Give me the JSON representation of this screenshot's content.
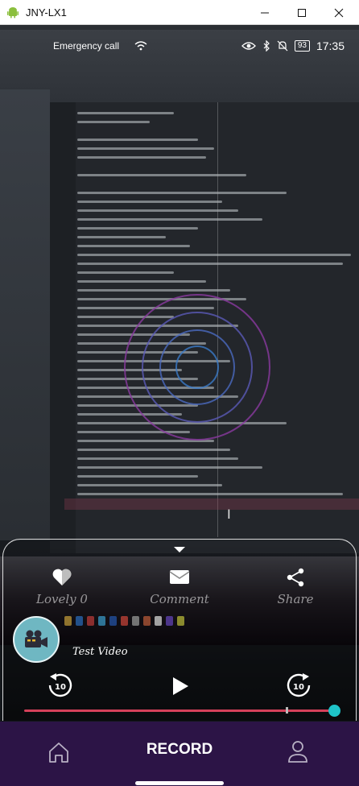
{
  "window": {
    "title": "JNY-LX1",
    "controls": [
      "minimize",
      "maximize",
      "close"
    ]
  },
  "statusbar": {
    "left_text": "Emergency call",
    "battery": "93",
    "time": "17:35"
  },
  "card": {
    "actions": {
      "lovely_label": "Lovely 0",
      "comment_label": "Comment",
      "share_label": "Share"
    },
    "video_title": "Test Video",
    "rewind_seconds": "10",
    "forward_seconds": "10",
    "progress_fraction": 0.99
  },
  "bottom_nav": {
    "record_label": "RECORD"
  },
  "colors": {
    "nav_bg": "#2c1446",
    "progress": "#d5405a",
    "knob": "#1ec3c8",
    "avatar": "#6fb7c2"
  },
  "icons": [
    "android-icon",
    "minimize-icon",
    "maximize-icon",
    "close-icon",
    "eye-icon",
    "bluetooth-icon",
    "mute-icon",
    "heart-icon",
    "mail-icon",
    "share-icon",
    "camcorder-icon",
    "rewind-10-icon",
    "play-icon",
    "forward-10-icon",
    "home-icon",
    "profile-icon"
  ]
}
